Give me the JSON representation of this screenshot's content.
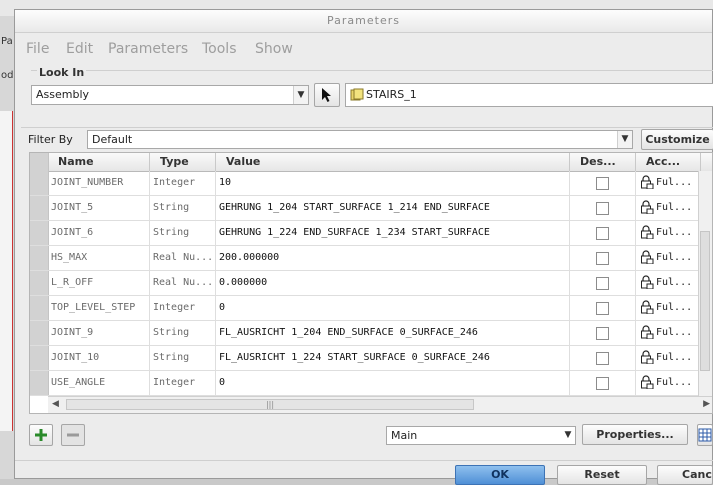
{
  "dialog": {
    "title": "Parameters"
  },
  "menu": [
    "File",
    "Edit",
    "Parameters",
    "Tools",
    "Show"
  ],
  "look_in": {
    "label": "Look In",
    "scope_value": "Assembly",
    "object_value": "STAIRS_1"
  },
  "filter": {
    "label": "Filter By",
    "value": "Default",
    "customize_label": "Customize"
  },
  "table": {
    "columns": [
      "Name",
      "Type",
      "Value",
      "Des...",
      "Acc..."
    ],
    "rows": [
      {
        "name": "JOINT_NUMBER",
        "type": "Integer",
        "value": "10",
        "access": "Ful..."
      },
      {
        "name": "JOINT_5",
        "type": "String",
        "value": "GEHRUNG 1_204 START_SURFACE 1_214 END_SURFACE",
        "access": "Ful..."
      },
      {
        "name": "JOINT_6",
        "type": "String",
        "value": "GEHRUNG 1_224 END_SURFACE 1_234 START_SURFACE",
        "access": "Ful..."
      },
      {
        "name": "HS_MAX",
        "type": "Real Nu...",
        "value": "200.000000",
        "access": "Ful..."
      },
      {
        "name": "L_R_OFF",
        "type": "Real Nu...",
        "value": "0.000000",
        "access": "Ful..."
      },
      {
        "name": "TOP_LEVEL_STEP",
        "type": "Integer",
        "value": "0",
        "access": "Ful..."
      },
      {
        "name": "JOINT_9",
        "type": "String",
        "value": "FL_AUSRICHT 1_204 END_SURFACE 0_SURFACE_246",
        "access": "Ful..."
      },
      {
        "name": "JOINT_10",
        "type": "String",
        "value": "FL_AUSRICHT 1_224 START_SURFACE 0_SURFACE_246",
        "access": "Ful..."
      },
      {
        "name": "USE_ANGLE",
        "type": "Integer",
        "value": "0",
        "access": "Ful..."
      }
    ]
  },
  "bottom": {
    "main_value": "Main",
    "properties_label": "Properties..."
  },
  "footer": {
    "ok_label": "OK",
    "reset_label": "Reset",
    "cancel_label": "Cance"
  },
  "background": {
    "left_texts": [
      "Pa",
      "odi"
    ]
  },
  "colors": {
    "accent": "#4f8fd6",
    "add_green": "#2a8a2a"
  }
}
